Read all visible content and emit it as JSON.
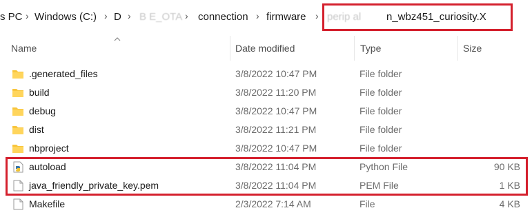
{
  "address_bar": {
    "crumbs": [
      "s PC",
      "Windows (C:)",
      "D",
      "B  E_OTA",
      "connection",
      "firmware"
    ],
    "current_folder_visible": "n_wbz451_curiosity.X",
    "current_folder_obscured": "perip      al"
  },
  "columns": {
    "name": "Name",
    "date": "Date modified",
    "type": "Type",
    "size": "Size"
  },
  "files": [
    {
      "name": ".generated_files",
      "date": "3/8/2022 10:47 PM",
      "type": "File folder",
      "size": "",
      "icon": "folder-icon"
    },
    {
      "name": "build",
      "date": "3/8/2022 11:20 PM",
      "type": "File folder",
      "size": "",
      "icon": "folder-icon"
    },
    {
      "name": "debug",
      "date": "3/8/2022 10:47 PM",
      "type": "File folder",
      "size": "",
      "icon": "folder-icon"
    },
    {
      "name": "dist",
      "date": "3/8/2022 11:21 PM",
      "type": "File folder",
      "size": "",
      "icon": "folder-icon"
    },
    {
      "name": "nbproject",
      "date": "3/8/2022 10:47 PM",
      "type": "File folder",
      "size": "",
      "icon": "folder-icon"
    },
    {
      "name": "autoload",
      "date": "3/8/2022 11:04 PM",
      "type": "Python File",
      "size": "90 KB",
      "icon": "python-file-icon"
    },
    {
      "name": "java_friendly_private_key.pem",
      "date": "3/8/2022 11:04 PM",
      "type": "PEM File",
      "size": "1 KB",
      "icon": "file-icon"
    },
    {
      "name": "Makefile",
      "date": "2/3/2022 7:14 AM",
      "type": "File",
      "size": "4 KB",
      "icon": "file-icon"
    }
  ],
  "colors": {
    "highlight": "#d4202d",
    "folder": "#f8c53c",
    "folder_dark": "#e0a82a"
  }
}
